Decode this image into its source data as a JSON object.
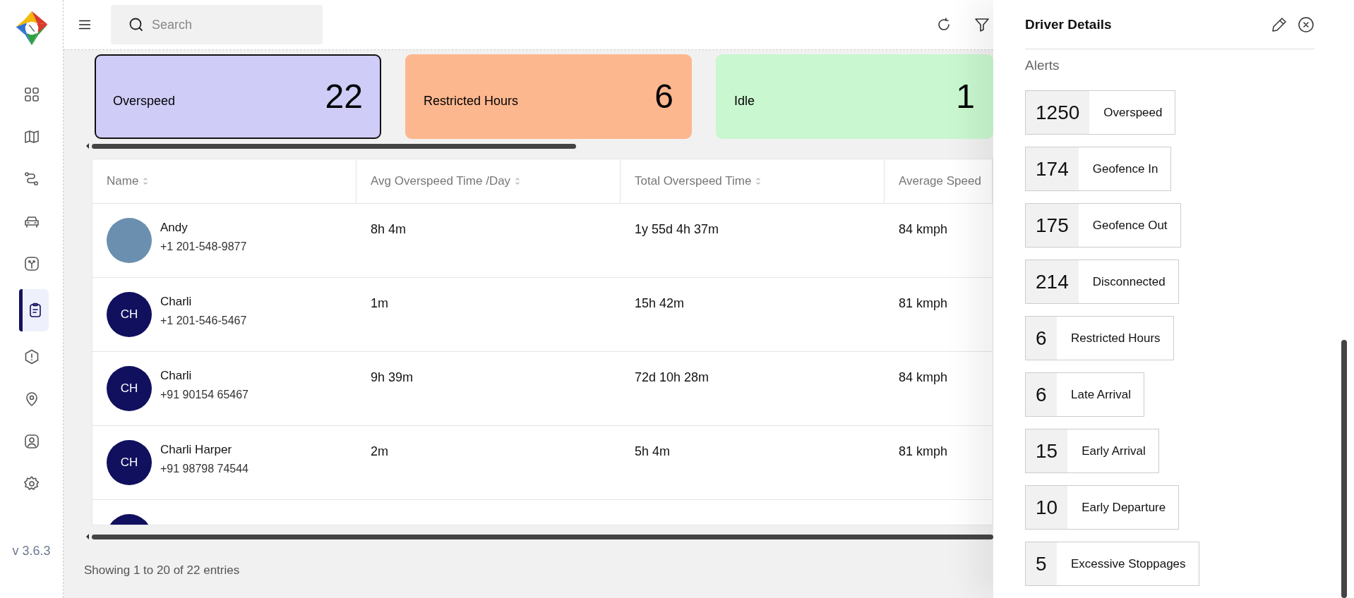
{
  "sidebar": {
    "items": [
      {
        "selected": false
      },
      {
        "selected": false
      },
      {
        "selected": false
      },
      {
        "selected": false
      },
      {
        "selected": false
      },
      {
        "selected": true
      },
      {
        "selected": false
      },
      {
        "selected": false
      },
      {
        "selected": false
      },
      {
        "selected": false
      }
    ],
    "version": "v 3.6.3"
  },
  "search": {
    "placeholder": "Search"
  },
  "cards": [
    {
      "label": "Overspeed",
      "count": "22",
      "color": "#cfccf8",
      "selected": true
    },
    {
      "label": "Restricted Hours",
      "count": "6",
      "color": "#fdb78e",
      "selected": false
    },
    {
      "label": "Idle",
      "count": "1",
      "color": "#c9f7cf",
      "selected": false
    }
  ],
  "table": {
    "columns": [
      {
        "label": "Name",
        "sortable": true
      },
      {
        "label": "Avg Overspeed Time /Day",
        "sortable": true
      },
      {
        "label": "Total Overspeed Time",
        "sortable": true
      },
      {
        "label": "Average Speed",
        "sortable": false
      }
    ],
    "rows": [
      {
        "avatar": {
          "kind": "photo"
        },
        "name": "Andy",
        "phone": "+1 201-548-9877",
        "avg_overspeed_per_day": "8h 4m",
        "total_overspeed": "1y 55d 4h 37m",
        "average_speed": "84 kmph"
      },
      {
        "avatar": {
          "kind": "initials",
          "text": "CH"
        },
        "name": "Charli",
        "phone": "+1 201-546-5467",
        "avg_overspeed_per_day": "1m",
        "total_overspeed": "15h 42m",
        "average_speed": "81 kmph"
      },
      {
        "avatar": {
          "kind": "initials",
          "text": "CH"
        },
        "name": "Charli",
        "phone": "+91 90154 65467",
        "avg_overspeed_per_day": "9h 39m",
        "total_overspeed": "72d 10h 28m",
        "average_speed": "84 kmph"
      },
      {
        "avatar": {
          "kind": "initials",
          "text": "CH"
        },
        "name": "Charli Harper",
        "phone": "+91 98798 74544",
        "avg_overspeed_per_day": "2m",
        "total_overspeed": "5h 4m",
        "average_speed": "81 kmph"
      }
    ]
  },
  "footer": "Showing 1 to 20 of 22 entries",
  "panel": {
    "title": "Driver Details",
    "section": "Alerts",
    "alerts": [
      {
        "count": "1250",
        "label": "Overspeed"
      },
      {
        "count": "174",
        "label": "Geofence In"
      },
      {
        "count": "175",
        "label": "Geofence Out"
      },
      {
        "count": "214",
        "label": "Disconnected"
      },
      {
        "count": "6",
        "label": "Restricted Hours"
      },
      {
        "count": "6",
        "label": "Late Arrival"
      },
      {
        "count": "15",
        "label": "Early Arrival"
      },
      {
        "count": "10",
        "label": "Early Departure"
      },
      {
        "count": "5",
        "label": "Excessive Stoppages"
      }
    ]
  }
}
